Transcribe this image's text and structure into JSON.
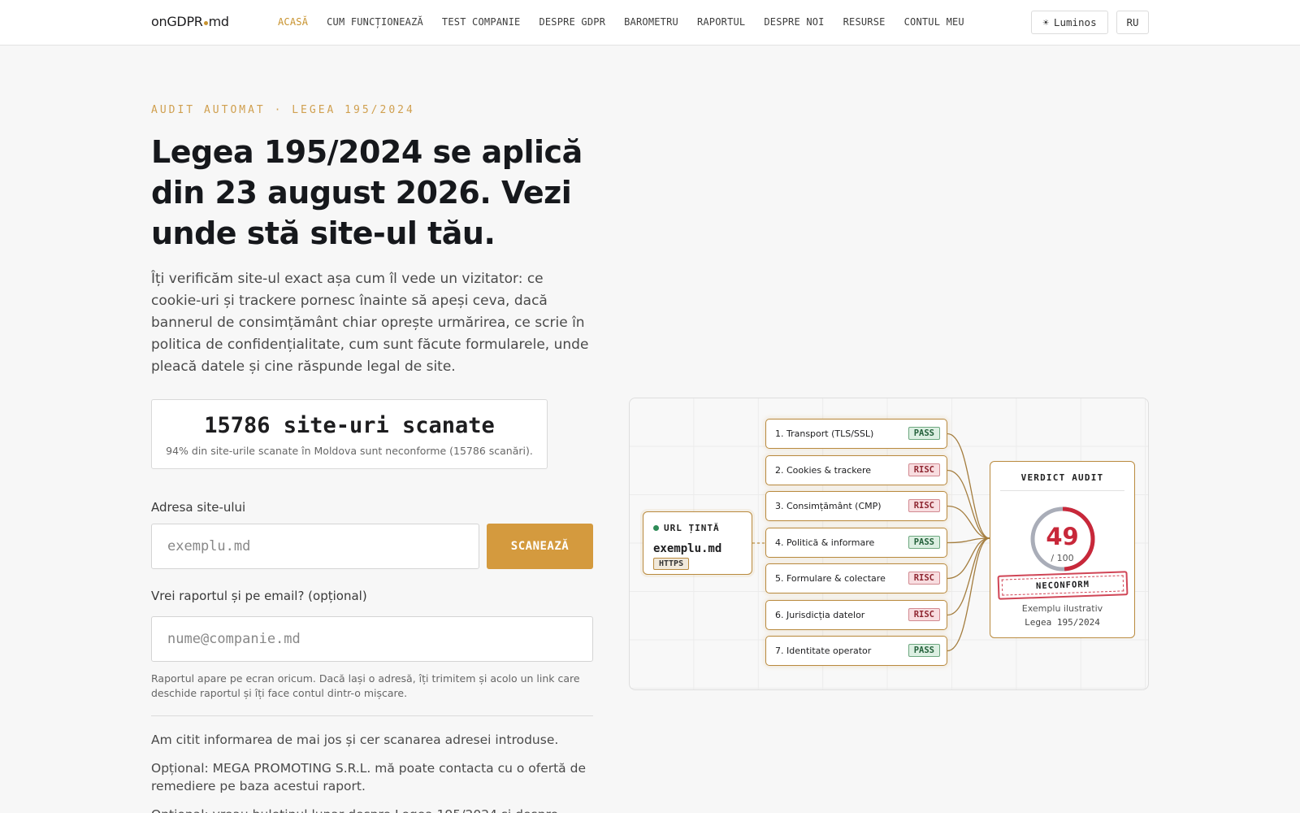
{
  "header": {
    "logo_pre": "onGDPR",
    "logo_post": "md",
    "nav": [
      {
        "label": "ACASĂ",
        "active": true
      },
      {
        "label": "CUM FUNCȚIONEAZĂ"
      },
      {
        "label": "TEST COMPANIE"
      },
      {
        "label": "DESPRE GDPR"
      },
      {
        "label": "BAROMETRU"
      },
      {
        "label": "RAPORTUL"
      },
      {
        "label": "DESPRE NOI"
      },
      {
        "label": "RESURSE"
      },
      {
        "label": "CONTUL MEU"
      }
    ],
    "theme_label": "Luminos",
    "theme_icon": "sun-icon",
    "lang_label": "RU"
  },
  "hero": {
    "eyebrow": "AUDIT AUTOMAT · LEGEA 195/2024",
    "title": "Legea 195/2024 se aplică din 23 august 2026. Vezi unde stă site-ul tău.",
    "description": "Îți verificăm site-ul exact așa cum îl vede un vizitator: ce cookie-uri și trackere pornesc înainte să apeși ceva, dacă bannerul de consimțământ chiar oprește urmărirea, ce scrie în politica de confidențialitate, cum sunt făcute formularele, unde pleacă datele și cine răspunde legal de site."
  },
  "stats": {
    "count_text": "15786 site-uri scanate",
    "note": "94% din site-urile scanate în Moldova sunt neconforme (15786 scanări)."
  },
  "form": {
    "url_label": "Adresa site-ului",
    "url_placeholder": "exemplu.md",
    "scan_button": "SCANEAZĂ",
    "email_label": "Vrei raportul și pe email? (opțional)",
    "email_placeholder": "nume@companie.md",
    "hint": "Raportul apare pe ecran oricum. Dacă lași o adresă, îți trimitem și acolo un link care deschide raportul și îți face contul dintr-o mișcare.",
    "consent_1": "Am citit informarea de mai jos și cer scanarea adresei introduse.",
    "consent_2": "Opțional: MEGA PROMOTING S.R.L. mă poate contacta cu o ofertă de remediere pe baza acestui raport.",
    "consent_3": "Opțional: vreau buletinul lunar despre Legea 195/2024 și despre"
  },
  "diagram": {
    "url_node": {
      "title": "URL ȚINTĂ",
      "value": "exemplu.md",
      "badge": "HTTPS",
      "status_color": "#2e8b57"
    },
    "checks": [
      {
        "label": "1. Transport (TLS/SSL)",
        "status": "PASS"
      },
      {
        "label": "2. Cookies & trackere",
        "status": "RISC"
      },
      {
        "label": "3. Consimțământ (CMP)",
        "status": "RISC"
      },
      {
        "label": "4. Politică & informare",
        "status": "PASS"
      },
      {
        "label": "5. Formulare & colectare",
        "status": "RISC"
      },
      {
        "label": "6. Jurisdicția datelor",
        "status": "RISC"
      },
      {
        "label": "7. Identitate operator",
        "status": "PASS"
      }
    ],
    "verdict": {
      "title": "VERDICT AUDIT",
      "score": "49",
      "max": "/ 100",
      "score_value": 49,
      "score_max": 100,
      "stamp": "NECONFORM",
      "note": "Exemplu ilustrativ",
      "law": "Legea 195/2024"
    }
  },
  "colors": {
    "accent": "#d49a3e",
    "node_border": "#b98a3e",
    "risk": "#c8283a",
    "pass": "#23603a"
  }
}
